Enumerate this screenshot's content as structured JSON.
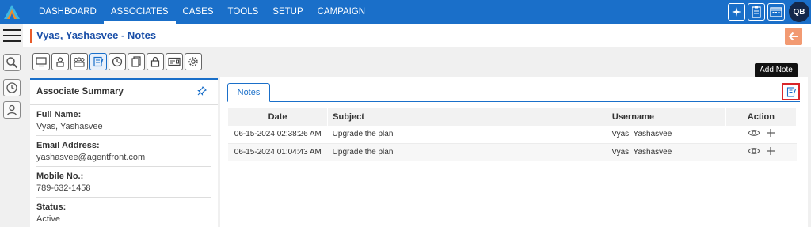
{
  "nav": {
    "items": [
      "DASHBOARD",
      "ASSOCIATES",
      "CASES",
      "TOOLS",
      "SETUP",
      "CAMPAIGN"
    ],
    "active": "ASSOCIATES"
  },
  "user": {
    "initials": "QB"
  },
  "header": {
    "title": "Vyas, Yashasvee - Notes"
  },
  "summary": {
    "title": "Associate Summary",
    "fields": [
      {
        "label": "Full Name:",
        "value": "Vyas, Yashasvee"
      },
      {
        "label": "Email Address:",
        "value": "yashasvee@agentfront.com"
      },
      {
        "label": "Mobile No.:",
        "value": "789-632-1458"
      },
      {
        "label": "Status:",
        "value": "Active"
      }
    ]
  },
  "notes": {
    "tab_label": "Notes",
    "tooltip": "Add Note",
    "columns": [
      "Date",
      "Subject",
      "Username",
      "Action"
    ],
    "rows": [
      {
        "date": "06-15-2024 02:38:26 AM",
        "subject": "Upgrade the plan",
        "username": "Vyas, Yashasvee"
      },
      {
        "date": "06-15-2024 01:04:43 AM",
        "subject": "Upgrade the plan",
        "username": "Vyas, Yashasvee"
      }
    ]
  },
  "colors": {
    "nav_bg": "#1a6fc9",
    "title": "#1a4fa8",
    "accent": "#e85b2a",
    "highlight": "#d9262a"
  }
}
